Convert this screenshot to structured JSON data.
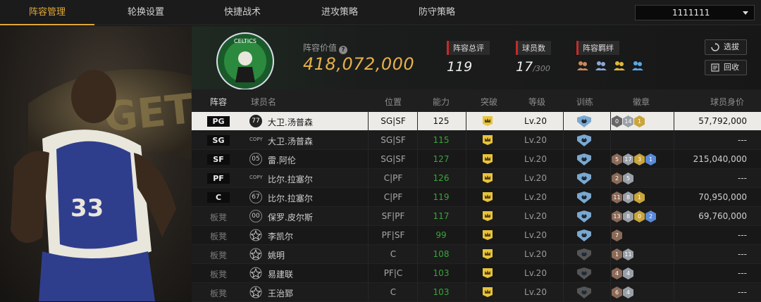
{
  "tabs": [
    "阵容管理",
    "轮换设置",
    "快捷战术",
    "进攻策略",
    "防守策略"
  ],
  "selector": {
    "value": "1111111"
  },
  "header": {
    "value_label": "阵容价值",
    "value": "418,072,000",
    "overall_label": "阵容总评",
    "overall": "119",
    "count_label": "球员数",
    "count": "17",
    "count_max": "/300",
    "bond_label": "阵容羁绊",
    "btn_select": "选拔",
    "btn_recycle": "回收"
  },
  "columns": [
    "阵容",
    "球员名",
    "位置",
    "能力",
    "突破",
    "等级",
    "训练",
    "徽章",
    "球员身价"
  ],
  "colors": {
    "accent": "#e0a83a",
    "ability": "#3aa43a"
  },
  "rows": [
    {
      "slot": "PG",
      "num": "77",
      "name": "大卫.汤普森",
      "pos": "SG|SF",
      "ability": "125",
      "level": "Lv.20",
      "badges": [
        "0",
        "14",
        "1"
      ],
      "price": "57,792,000"
    },
    {
      "slot": "SG",
      "num": "COPY",
      "name": "大卫.汤普森",
      "pos": "SG|SF",
      "ability": "115",
      "level": "Lv.20",
      "badges": [],
      "price": "---"
    },
    {
      "slot": "SF",
      "num": "05",
      "name": "雷.阿伦",
      "pos": "SG|SF",
      "ability": "127",
      "level": "Lv.20",
      "badges": [
        "5",
        "17",
        "3",
        "1"
      ],
      "price": "215,040,000"
    },
    {
      "slot": "PF",
      "num": "COPY",
      "name": "比尔.拉塞尔",
      "pos": "C|PF",
      "ability": "126",
      "level": "Lv.20",
      "badges": [
        "2",
        "5"
      ],
      "price": "---"
    },
    {
      "slot": "C",
      "num": "67",
      "name": "比尔.拉塞尔",
      "pos": "C|PF",
      "ability": "119",
      "level": "Lv.20",
      "badges": [
        "11",
        "8",
        "1"
      ],
      "price": "70,950,000"
    },
    {
      "slot": "板凳",
      "num": "00",
      "name": "保罗.皮尔斯",
      "pos": "SF|PF",
      "ability": "117",
      "level": "Lv.20",
      "badges": [
        "13",
        "8",
        "0",
        "2"
      ],
      "price": "69,760,000"
    },
    {
      "slot": "板凳",
      "num": "STAR",
      "name": "李凯尔",
      "pos": "PF|SF",
      "ability": "99",
      "level": "Lv.20",
      "badges": [
        "7"
      ],
      "price": "---"
    },
    {
      "slot": "板凳",
      "num": "STAR",
      "name": "姚明",
      "pos": "C",
      "ability": "108",
      "level": "Lv.20",
      "badges": [
        "1",
        "11"
      ],
      "price": "---"
    },
    {
      "slot": "板凳",
      "num": "STAR",
      "name": "易建联",
      "pos": "PF|C",
      "ability": "103",
      "level": "Lv.20",
      "badges": [
        "4",
        "4"
      ],
      "price": "---"
    },
    {
      "slot": "板凳",
      "num": "STAR",
      "name": "王治郅",
      "pos": "C",
      "ability": "103",
      "level": "Lv.20",
      "badges": [
        "6",
        "4"
      ],
      "price": "---"
    }
  ]
}
